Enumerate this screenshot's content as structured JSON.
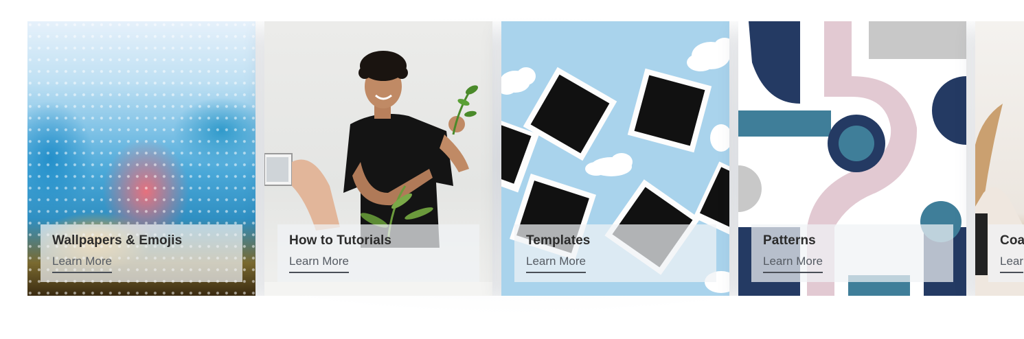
{
  "cards": [
    {
      "title": "Wallpapers & Emojis",
      "link": "Learn More",
      "image": "rainy-window-image"
    },
    {
      "title": "How to Tutorials",
      "link": "Learn More",
      "image": "man-filming-plant-image"
    },
    {
      "title": "Templates",
      "link": "Learn More",
      "image": "polaroid-frames-clouds-image"
    },
    {
      "title": "Patterns",
      "link": "Learn More",
      "image": "geometric-pattern-image"
    },
    {
      "title": "Coa",
      "link": "Lear",
      "image": "woman-portrait-image"
    }
  ],
  "colors": {
    "info_panel": "#f0f2f5",
    "title_text": "#2b2b2b",
    "link_text": "#555b63",
    "templates_bg": "#a9d3ec",
    "pattern_navy": "#243a63",
    "pattern_pink": "#e2c9d2",
    "pattern_teal": "#3f7e99"
  }
}
